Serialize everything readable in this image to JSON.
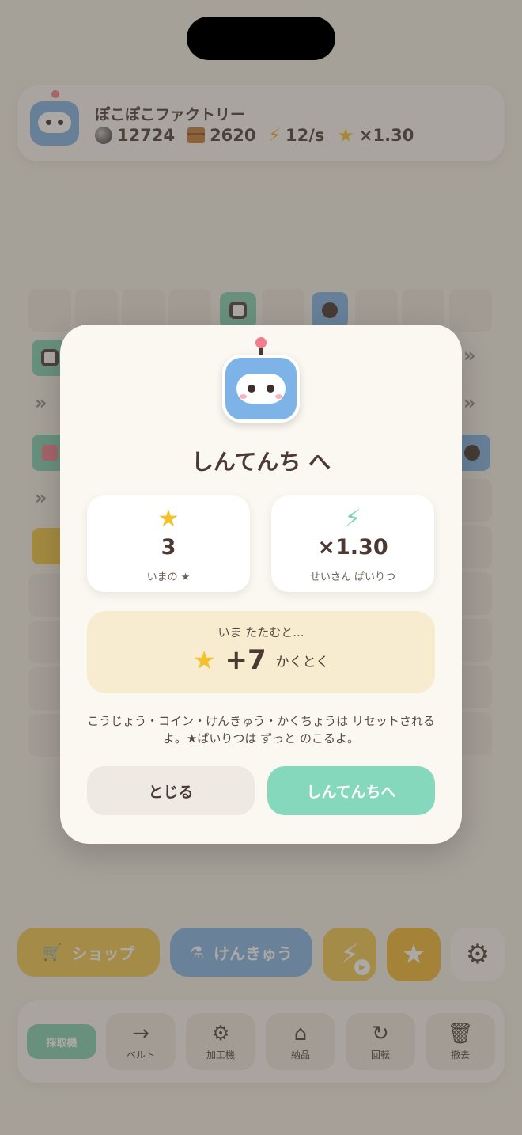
{
  "header": {
    "title": "ぽこぽこファクトリー",
    "coins": "12724",
    "boxes": "2620",
    "rate": "12/s",
    "multiplier": "×1.30"
  },
  "icons": {
    "coin": "moon-coin-icon",
    "box": "cardboard-box-icon",
    "rate": "lightning-icon",
    "multiplier": "star-icon"
  },
  "actions": {
    "shop_label": "ショップ",
    "research_label": "けんきゅう"
  },
  "toolbar": {
    "items": [
      {
        "label": "採取機",
        "icon": ""
      },
      {
        "label": "ベルト",
        "icon": "→"
      },
      {
        "label": "加工機",
        "icon": "⚙"
      },
      {
        "label": "納品",
        "icon": "⌂"
      },
      {
        "label": "回転",
        "icon": "↻"
      },
      {
        "label": "撤去",
        "icon": "🗑"
      }
    ]
  },
  "modal": {
    "title": "しんてんち へ",
    "current_stars": "3",
    "current_stars_label": "いまの ★",
    "production_multiplier": "×1.30",
    "production_multiplier_label": "せいさん ばいりつ",
    "gain_intro": "いま たたむと...",
    "gain_value": "+7",
    "gain_suffix": "かくとく",
    "note": "こうじょう・コイン・けんきゅう・かくちょうは リセットされるよ。★ばいりつは ずっと のこるよ。",
    "close_label": "とじる",
    "confirm_label": "しんてんちへ"
  },
  "colors": {
    "accent_green": "#86d8bd",
    "accent_blue": "#7db3e6",
    "accent_yellow": "#f2c74d",
    "star": "#f3c12d",
    "text": "#4a3a33"
  }
}
